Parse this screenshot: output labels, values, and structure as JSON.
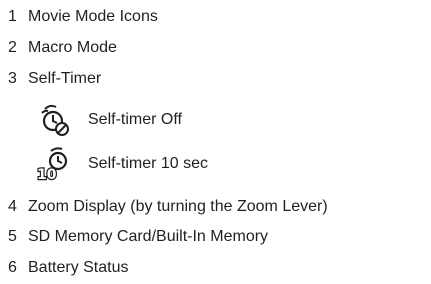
{
  "items": [
    {
      "num": "1",
      "label": "Movie Mode Icons"
    },
    {
      "num": "2",
      "label": "Macro Mode"
    },
    {
      "num": "3",
      "label": "Self-Timer"
    },
    {
      "num": "4",
      "label": "Zoom Display (by turning the Zoom Lever)"
    },
    {
      "num": "5",
      "label": "SD Memory Card/Built-In Memory"
    },
    {
      "num": "6",
      "label": "Battery Status"
    }
  ],
  "self_timer_options": [
    {
      "icon": "self-timer-off-icon",
      "label": "Self-timer Off"
    },
    {
      "icon": "self-timer-10sec-icon",
      "label": "Self-timer 10 sec",
      "icon_text": "10"
    }
  ],
  "colors": {
    "text": "#231f20"
  }
}
